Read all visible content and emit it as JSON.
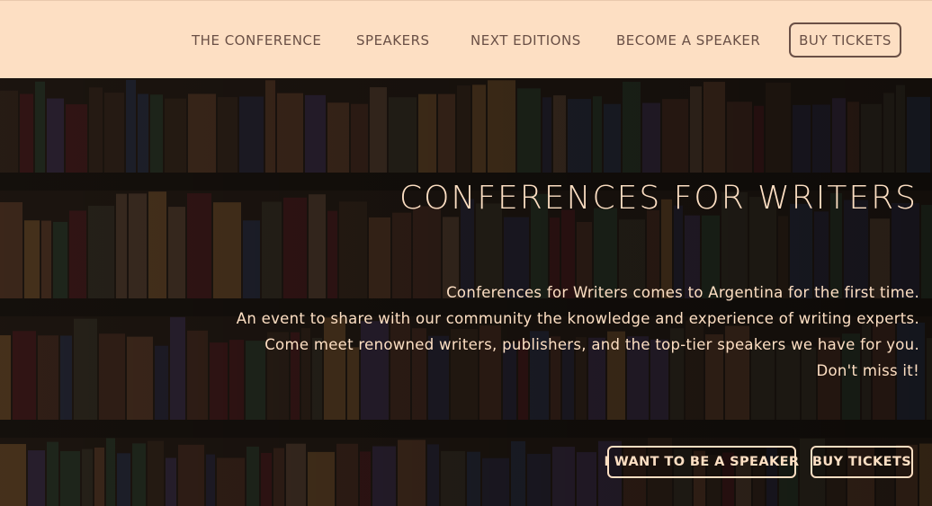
{
  "nav": {
    "links": [
      "THE CONFERENCE",
      "SPEAKERS",
      "NEXT EDITIONS",
      "BECOME A SPEAKER"
    ],
    "cta": "BUY TICKETS"
  },
  "hero": {
    "title": "CONFERENCES FOR WRITERS",
    "lines": [
      "Conferences for Writers comes to Argentina for the first time.",
      "An event to share with our community the knowledge and experience of writing experts.",
      "Come meet renowned writers, publishers, and the top-tier speakers we have for you.",
      "Don't miss it!"
    ],
    "speaker_button": "I WANT TO BE A SPEAKER",
    "tickets_button": "BUY TICKETS"
  },
  "colors": {
    "navbar_bg": "#fddfc3",
    "nav_text": "#6a5046",
    "hero_text": "#fddfc3"
  }
}
